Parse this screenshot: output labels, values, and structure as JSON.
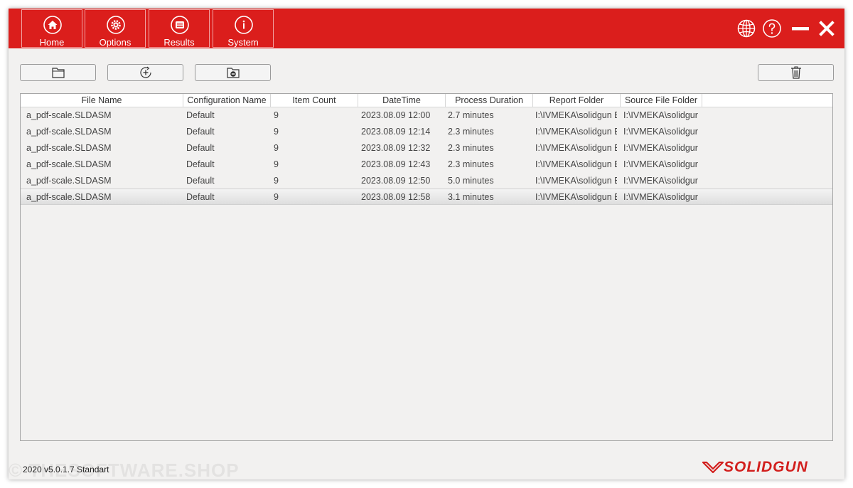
{
  "nav": {
    "items": [
      {
        "label": "Home",
        "icon": "home-icon"
      },
      {
        "label": "Options",
        "icon": "gear-icon"
      },
      {
        "label": "Results",
        "icon": "list-icon"
      },
      {
        "label": "System",
        "icon": "info-icon"
      }
    ]
  },
  "topbar_icons": [
    "globe-icon",
    "help-icon",
    "minimize-icon",
    "close-icon"
  ],
  "toolbar": [
    "open-folder-icon",
    "add-circle-icon",
    "folder-remove-icon",
    "trash-icon"
  ],
  "table": {
    "columns": [
      "File Name",
      "Configuration Name",
      "Item Count",
      "DateTime",
      "Process Duration",
      "Report Folder",
      "Source File Folder"
    ],
    "rows": [
      [
        "a_pdf-scale.SLDASM",
        "Default",
        "9",
        "2023.08.09 12:00",
        "2.7 minutes",
        "I:\\IVMEKA\\solidgun E",
        "I:\\IVMEKA\\solidgur"
      ],
      [
        "a_pdf-scale.SLDASM",
        "Default",
        "9",
        "2023.08.09 12:14",
        "2.3 minutes",
        "I:\\IVMEKA\\solidgun E",
        "I:\\IVMEKA\\solidgur"
      ],
      [
        "a_pdf-scale.SLDASM",
        "Default",
        "9",
        "2023.08.09 12:32",
        "2.3 minutes",
        "I:\\IVMEKA\\solidgun E",
        "I:\\IVMEKA\\solidgur"
      ],
      [
        "a_pdf-scale.SLDASM",
        "Default",
        "9",
        "2023.08.09 12:43",
        "2.3 minutes",
        "I:\\IVMEKA\\solidgun E",
        "I:\\IVMEKA\\solidgur"
      ],
      [
        "a_pdf-scale.SLDASM",
        "Default",
        "9",
        "2023.08.09 12:50",
        "5.0 minutes",
        "I:\\IVMEKA\\solidgun E",
        "I:\\IVMEKA\\solidgur"
      ],
      [
        "a_pdf-scale.SLDASM",
        "Default",
        "9",
        "2023.08.09 12:58",
        "3.1 minutes",
        "I:\\IVMEKA\\solidgun E",
        "I:\\IVMEKA\\solidgur"
      ]
    ],
    "selected_row": 5
  },
  "footer": {
    "version": "2020 v5.0.1.7 Standart",
    "watermark": "© THESOFTWARE.SHOP",
    "logo_text": "SOLIDGUN"
  },
  "colors": {
    "brand_red": "#db1e1c",
    "logo_red": "#d21f1d"
  }
}
